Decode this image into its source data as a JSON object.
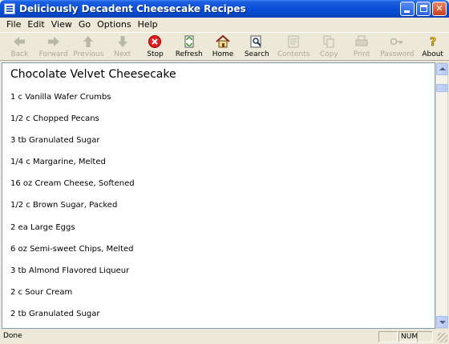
{
  "window": {
    "title": "Deliciously Decadent Cheesecake Recipes"
  },
  "menu": [
    "File",
    "Edit",
    "View",
    "Go",
    "Options",
    "Help"
  ],
  "toolbar": {
    "back": "Back",
    "forward": "Forward",
    "previous": "Previous",
    "next": "Next",
    "stop": "Stop",
    "refresh": "Refresh",
    "home": "Home",
    "search": "Search",
    "contents": "Contents",
    "copy": "Copy",
    "print": "Print",
    "password": "Password",
    "about": "About"
  },
  "recipe": {
    "title": "Chocolate Velvet Cheesecake",
    "ingredients": [
      "1 c Vanilla Wafer Crumbs",
      "1/2 c Chopped Pecans",
      "3 tb Granulated Sugar",
      "1/4 c Margarine, Melted",
      "16 oz Cream Cheese, Softened",
      "1/2 c Brown Sugar, Packed",
      "2 ea Large Eggs",
      "6 oz Semi-sweet Chips, Melted",
      "3 tb Almond Flavored Liqueur",
      "2 c Sour Cream",
      "2 tb Granulated Sugar"
    ]
  },
  "status": {
    "text": "Done",
    "num": "NUM"
  },
  "colors": {
    "titlebar": "#0a4fd8",
    "chrome": "#ece9d8",
    "stop_icon": "#e02020"
  }
}
